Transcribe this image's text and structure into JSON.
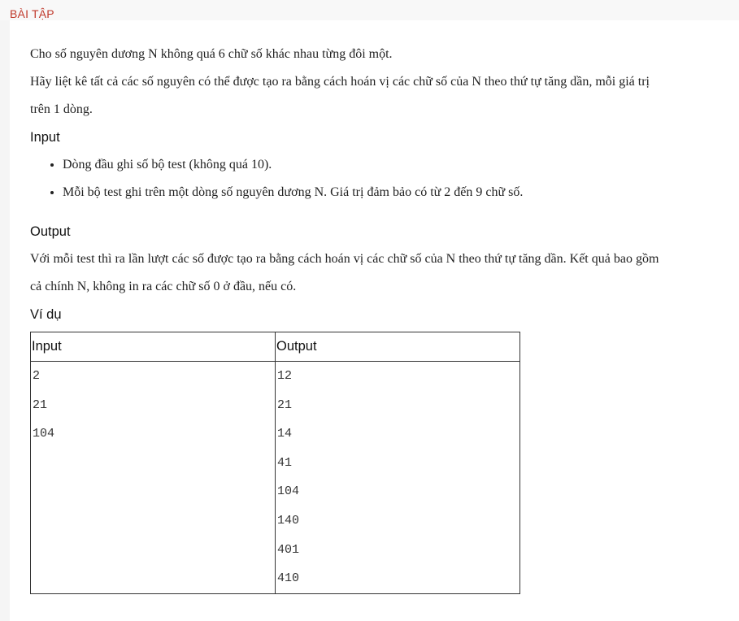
{
  "section_label": "BÀI TẬP",
  "problem": {
    "intro": "Cho số nguyên dương N không quá 6 chữ số khác nhau từng đôi một.",
    "task_line1": "Hãy liệt kê tất cả các số nguyên có thể được tạo ra bằng cách hoán vị các chữ số của N theo thứ tự tăng dần, mỗi giá trị",
    "task_line2": "trên 1 dòng."
  },
  "input_section": {
    "heading": "Input",
    "bullets": [
      "Dòng đầu ghi số bộ test (không quá 10).",
      "Mỗi bộ test ghi trên một dòng số nguyên dương N. Giá trị đảm bảo có từ 2 đến 9 chữ số."
    ]
  },
  "output_section": {
    "heading": "Output",
    "line1": "Với mỗi test thì ra lần lượt các số được tạo ra bằng cách hoán vị các chữ số của N theo thứ tự tăng dần. Kết quả bao gồm",
    "line2": "cả chính N, không in ra các chữ số 0 ở đầu, nếu có."
  },
  "example": {
    "heading": "Ví dụ",
    "columns": [
      "Input",
      "Output"
    ],
    "input_lines": [
      "2",
      "21",
      "104"
    ],
    "output_lines": [
      "12",
      "21",
      "14",
      "41",
      "104",
      "140",
      "401",
      "410"
    ]
  }
}
